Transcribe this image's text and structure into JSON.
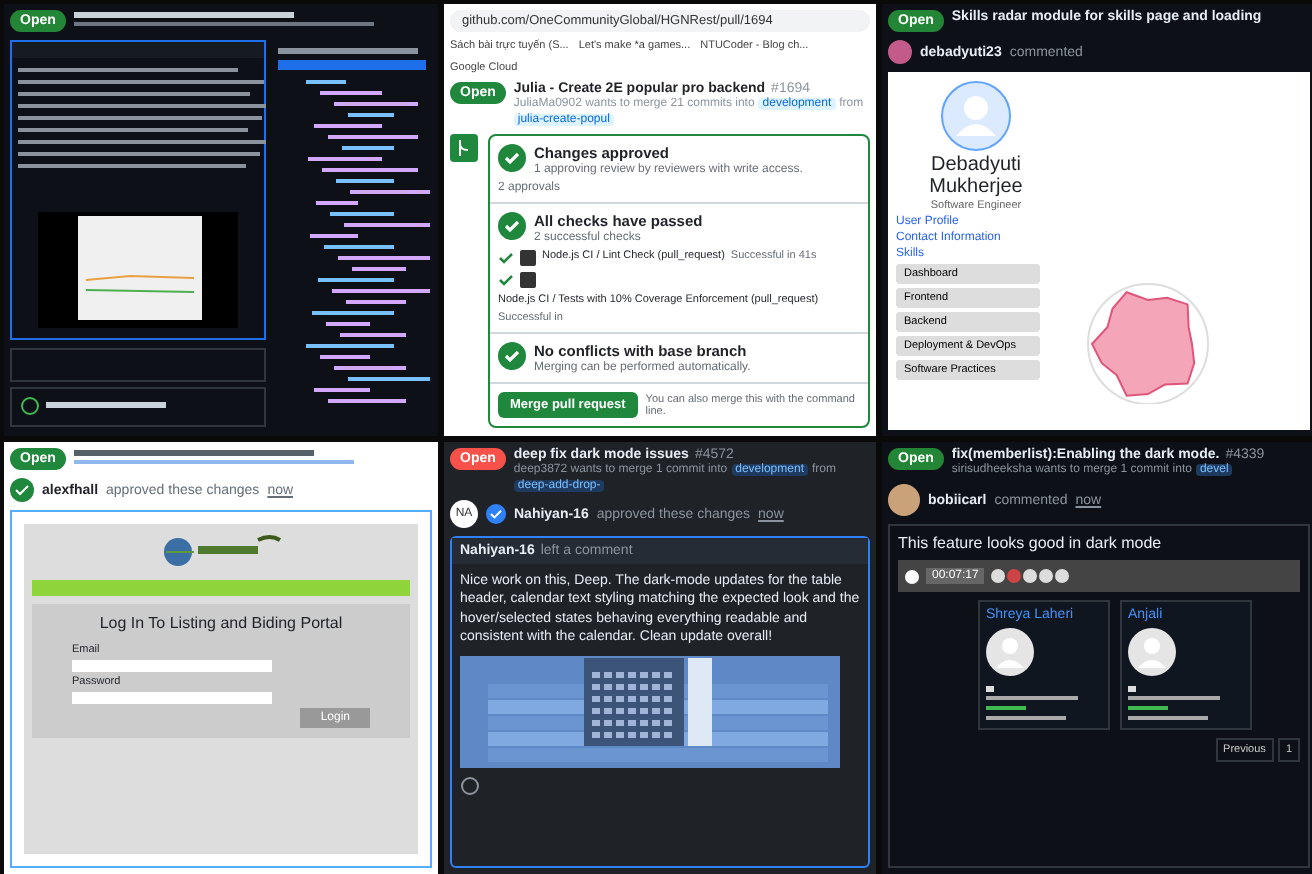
{
  "panels": [
    {
      "kind": "dark_review",
      "badge": {
        "label": "Open",
        "color": "#238636"
      }
    },
    {
      "kind": "checks",
      "url": "github.com/OneCommunityGlobal/HGNRest/pull/1694",
      "bookmarks": [
        "Sách bài trực tuyến (S...",
        "Let's make *a games...",
        "NTUCoder - Blog ch...",
        "Google Cloud"
      ],
      "badge": {
        "label": "Open",
        "color": "#1f883d"
      },
      "title": "Julia - Create 2E popular pro backend",
      "number": "#1694",
      "meta": [
        {
          "kind": "text",
          "text": "JuliaMa0902 wants to merge 21 commits into"
        },
        {
          "kind": "branch",
          "text": "development"
        },
        {
          "kind": "text",
          "text": "from"
        },
        {
          "kind": "branch",
          "text": "julia-create-popul"
        }
      ],
      "sections": [
        {
          "title": "Changes approved",
          "detail": "1 approving review by reviewers with write access.",
          "link": "2 approvals"
        },
        {
          "title": "All checks have passed",
          "detail": "2 successful checks",
          "runs": [
            {
              "name": "Node.js CI / Lint Check (pull_request)",
              "result": "Successful in 41s"
            },
            {
              "name": "Node.js CI / Tests with 10% Coverage Enforcement (pull_request)",
              "result": "Successful in"
            }
          ]
        },
        {
          "title": "No conflicts with base branch",
          "detail": "Merging can be performed automatically."
        }
      ],
      "merge_button": "Merge pull request",
      "merge_note": "You can also merge this with the command line."
    },
    {
      "kind": "profile",
      "badge": {
        "label": "Open",
        "color": "#238636"
      },
      "title": "Skills radar module for skills page and loading",
      "author": "debadyuti23",
      "action": "commented",
      "name": "Debadyuti Mukherjee",
      "role": "Software Engineer",
      "links": [
        "User Profile",
        "Contact Information",
        "Skills"
      ],
      "skills": [
        "Dashboard",
        "Frontend",
        "Backend",
        "Deployment & DevOps",
        "Software Practices"
      ]
    },
    {
      "kind": "login_review",
      "badge": {
        "label": "Open",
        "color": "#1f883d"
      },
      "reviewer": "alexfhall",
      "action": "approved these changes",
      "time": "now",
      "login_title": "Log In To Listing and Biding Portal",
      "fields": [
        {
          "label": "Email"
        },
        {
          "label": "Password"
        }
      ],
      "button": "Login"
    },
    {
      "kind": "dark_comment",
      "badge": {
        "label": "Open",
        "color": "#f85149"
      },
      "title": "deep fix dark mode issues",
      "number": "#4572",
      "meta": [
        {
          "kind": "text",
          "text": "deep3872 wants to merge 1 commit into"
        },
        {
          "kind": "branch",
          "text": "development"
        },
        {
          "kind": "text",
          "text": "from"
        },
        {
          "kind": "branch",
          "text": "deep-add-drop-"
        }
      ],
      "avatar": "NA",
      "reviewer": "Nahiyan-16",
      "action": "approved these changes",
      "time": "now",
      "commenter": "Nahiyan-16",
      "comment_head": "left a comment",
      "comment": "Nice work on this, Deep. The dark-mode updates for the table header, calendar text styling matching the expected look and the hover/selected states behaving everything readable and consistent with the calendar. Clean update overall!"
    },
    {
      "kind": "memberlist",
      "badge": {
        "label": "Open",
        "color": "#238636"
      },
      "title": "fix(memberlist):Enabling the dark mode.",
      "number": "#4339",
      "meta": [
        {
          "kind": "text",
          "text": "sirisudheeksha wants to merge 1 commit into"
        },
        {
          "kind": "branch",
          "text": "devel"
        }
      ],
      "author": "bobiicarl",
      "action": "commented",
      "time": "now",
      "comment": "This feature looks good in dark mode",
      "timer": "00:07:17",
      "members": [
        {
          "name": "Shreya Laheri"
        },
        {
          "name": "Anjali"
        }
      ],
      "pager": [
        "Previous",
        "1"
      ]
    }
  ]
}
